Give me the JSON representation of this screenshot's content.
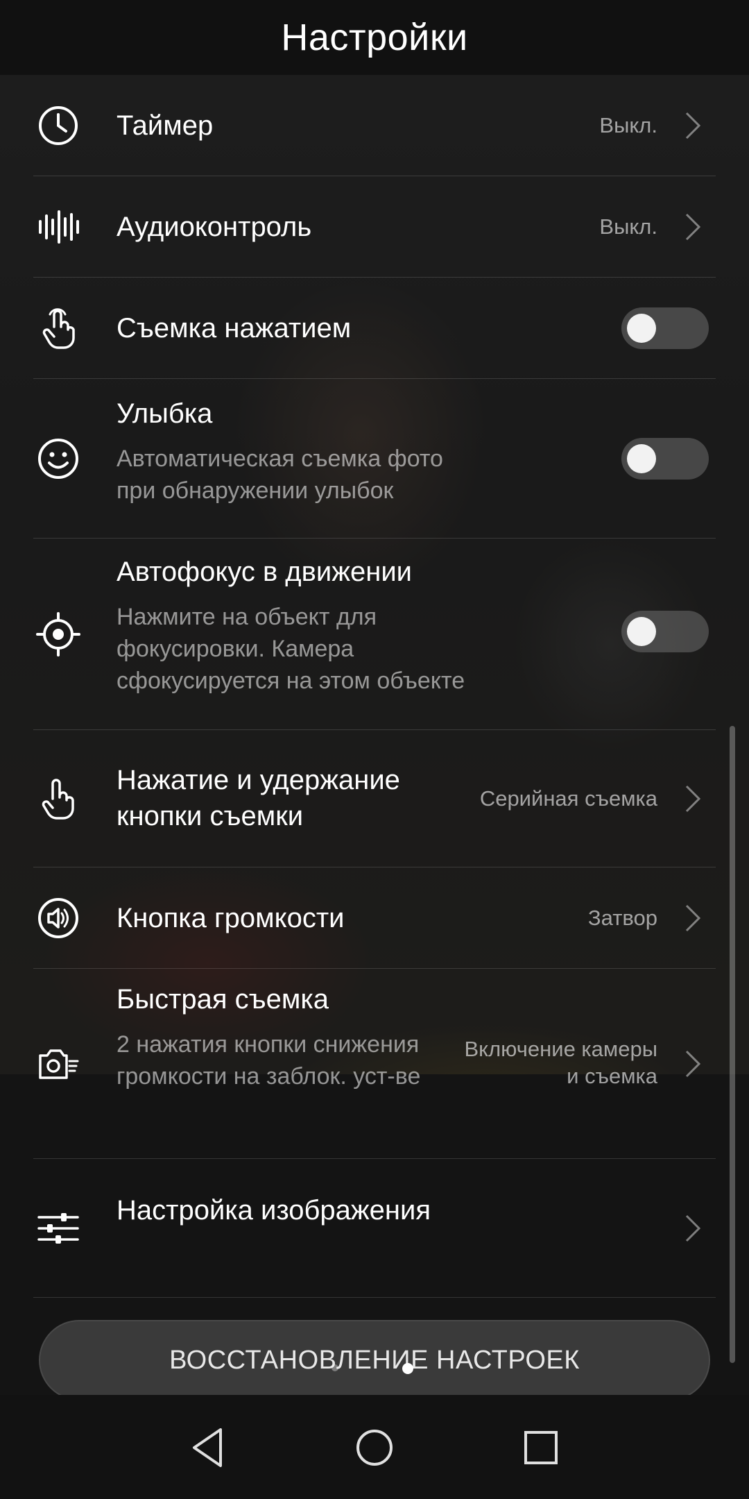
{
  "header": {
    "title": "Настройки"
  },
  "settings": [
    {
      "label": "Таймер",
      "value": "Выкл."
    },
    {
      "label": "Аудиоконтроль",
      "value": "Выкл."
    },
    {
      "label": "Съемка нажатием",
      "toggle": false
    },
    {
      "label": "Улыбка",
      "desc": "Автоматическая съемка фото при обнаружении улыбок",
      "toggle": false
    },
    {
      "label": "Автофокус в движении",
      "desc": "Нажмите на объект для фокусировки. Камера сфокусируется на этом объекте",
      "toggle": false
    },
    {
      "label": "Нажатие и удержание кнопки съемки",
      "value": "Серийная съемка"
    },
    {
      "label": "Кнопка громкости",
      "value": "Затвор"
    },
    {
      "label": "Быстрая съемка",
      "desc": "2 нажатия кнопки снижения громкости на заблок. уст-ве",
      "value": "Включение камеры и съемка"
    },
    {
      "label": "Настройка изображения"
    }
  ],
  "reset_button": {
    "label": "ВОССТАНОВЛЕНИЕ НАСТРОЕК"
  },
  "icons": {
    "timer": "clock-icon",
    "audio": "soundwave-icon",
    "touch": "touch-hand-icon",
    "smile": "smile-icon",
    "autofocus": "target-icon",
    "hold": "press-hand-icon",
    "volume": "volume-icon",
    "quick": "quick-camera-icon",
    "adjust": "sliders-icon"
  },
  "colors": {
    "background": "#141414",
    "toggle_off": "#6e6e6e",
    "button": "#3a3a3a"
  }
}
